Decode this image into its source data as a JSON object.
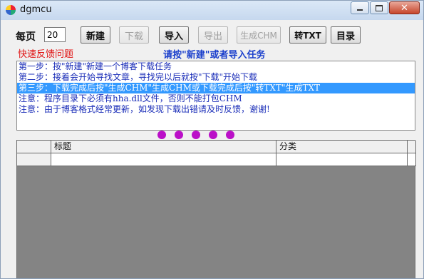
{
  "window": {
    "title": "dgmcu"
  },
  "toolbar": {
    "per_page_label": "每页",
    "per_page_value": "20",
    "buttons": {
      "new": "新建",
      "download": "下载",
      "import": "导入",
      "export": "导出",
      "gen_chm": "生成CHM",
      "to_txt": "转TXT",
      "catalog": "目录"
    }
  },
  "feedback_link": "快速反馈问题",
  "banner": "请按\"新建\"或者导入任务",
  "log": [
    "第一步：按\"新建\"新建一个博客下载任务",
    "第二步：接着会开始寻找文章，寻找完以后就按\"下载\"开始下载",
    "第三步：下载完成后按\"生成CHM\"生成CHM或下载完成后按\"转TXT\"生成TXT",
    "注意：程序目录下必须有hha.dll文件，否则不能打包CHM",
    "注意：由于博客格式经常更新，如发现下载出错请及时反馈，谢谢!"
  ],
  "grid": {
    "columns": [
      "",
      "标题",
      "分类",
      ""
    ]
  },
  "colors": {
    "accent_blue": "#1a3fcc",
    "feedback_red": "#e01010",
    "selection": "#3399ff",
    "dots": "#bb10c8"
  }
}
